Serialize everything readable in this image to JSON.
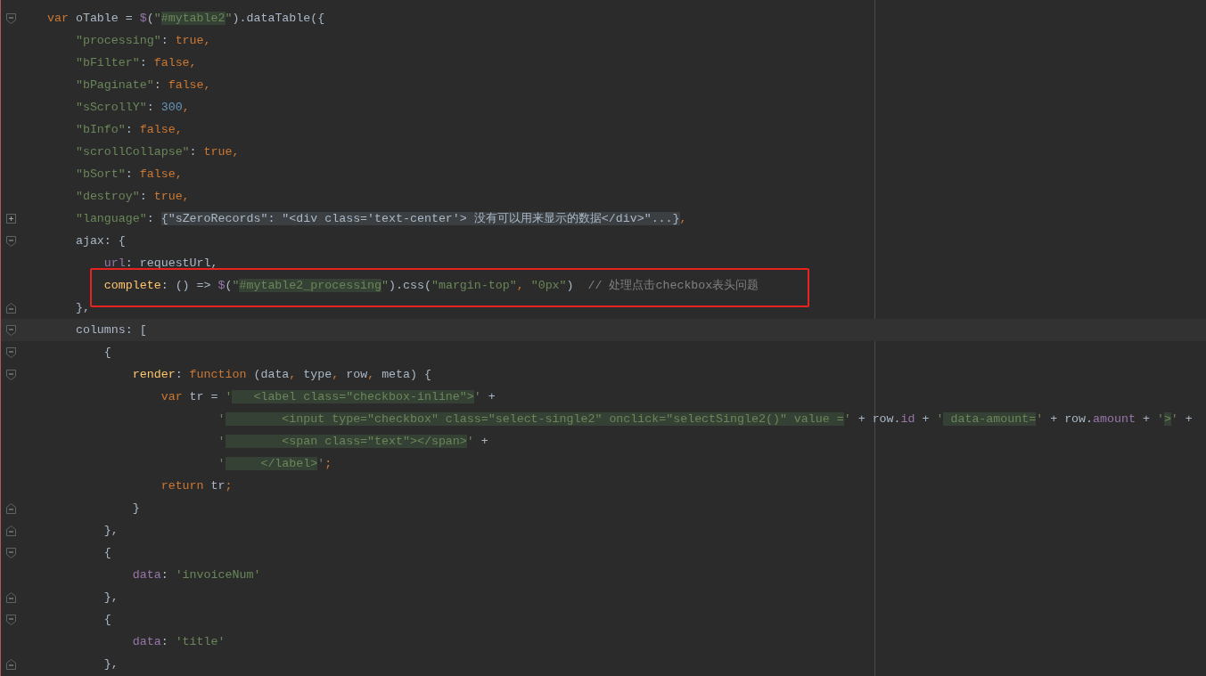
{
  "editor": {
    "lines": [
      {
        "kind": "fold-start",
        "tokens": [
          {
            "text": "var ",
            "kind": "keyword"
          },
          {
            "text": "oTable = ",
            "kind": "plain"
          },
          {
            "text": "$",
            "kind": "field"
          },
          {
            "text": "(",
            "kind": "plain"
          },
          {
            "text": "\"",
            "kind": "string"
          },
          {
            "text": "#mytable2",
            "kind": "injected"
          },
          {
            "text": "\"",
            "kind": "string"
          },
          {
            "text": ").dataTable({",
            "kind": "plain"
          }
        ]
      },
      {
        "kind": "plain",
        "tokens": [
          {
            "text": "    \"processing\"",
            "kind": "string"
          },
          {
            "text": ": ",
            "kind": "plain"
          },
          {
            "text": "true,",
            "kind": "keyword"
          }
        ]
      },
      {
        "kind": "plain",
        "tokens": [
          {
            "text": "    \"bFilter\"",
            "kind": "string"
          },
          {
            "text": ": ",
            "kind": "plain"
          },
          {
            "text": "false,",
            "kind": "keyword"
          }
        ]
      },
      {
        "kind": "plain",
        "tokens": [
          {
            "text": "    \"bPaginate\"",
            "kind": "string"
          },
          {
            "text": ": ",
            "kind": "plain"
          },
          {
            "text": "false,",
            "kind": "keyword"
          }
        ]
      },
      {
        "kind": "plain",
        "tokens": [
          {
            "text": "    \"sScrollY\"",
            "kind": "string"
          },
          {
            "text": ": ",
            "kind": "plain"
          },
          {
            "text": "300",
            "kind": "number"
          },
          {
            "text": ",",
            "kind": "keyword"
          }
        ]
      },
      {
        "kind": "plain",
        "tokens": [
          {
            "text": "    \"bInfo\"",
            "kind": "string"
          },
          {
            "text": ": ",
            "kind": "plain"
          },
          {
            "text": "false,",
            "kind": "keyword"
          }
        ]
      },
      {
        "kind": "plain",
        "tokens": [
          {
            "text": "    \"scrollCollapse\"",
            "kind": "string"
          },
          {
            "text": ": ",
            "kind": "plain"
          },
          {
            "text": "true,",
            "kind": "keyword"
          }
        ]
      },
      {
        "kind": "plain",
        "tokens": [
          {
            "text": "    \"bSort\"",
            "kind": "string"
          },
          {
            "text": ": ",
            "kind": "plain"
          },
          {
            "text": "false,",
            "kind": "keyword"
          }
        ]
      },
      {
        "kind": "plain",
        "tokens": [
          {
            "text": "    \"destroy\"",
            "kind": "string"
          },
          {
            "text": ": ",
            "kind": "plain"
          },
          {
            "text": "true,",
            "kind": "keyword"
          }
        ]
      },
      {
        "kind": "folded",
        "tokens": [
          {
            "text": "    \"language\"",
            "kind": "string"
          },
          {
            "text": ": ",
            "kind": "plain"
          },
          {
            "text": "{\"sZeroRecords\": \"<div class='text-center'> 没有可以用来显示的数据</div>\"...}",
            "kind": "folded"
          },
          {
            "text": ",",
            "kind": "keyword"
          }
        ]
      },
      {
        "kind": "fold-start",
        "tokens": [
          {
            "text": "    ajax: {",
            "kind": "plain"
          }
        ]
      },
      {
        "kind": "plain",
        "tokens": [
          {
            "text": "        url",
            "kind": "field"
          },
          {
            "text": ": requestUrl,",
            "kind": "plain"
          }
        ]
      },
      {
        "kind": "plain",
        "annotated": true,
        "tokens": [
          {
            "text": "        complete",
            "kind": "function"
          },
          {
            "text": ": () => ",
            "kind": "plain"
          },
          {
            "text": "$",
            "kind": "field"
          },
          {
            "text": "(",
            "kind": "plain"
          },
          {
            "text": "\"",
            "kind": "string"
          },
          {
            "text": "#mytable2_processing",
            "kind": "injected"
          },
          {
            "text": "\"",
            "kind": "string"
          },
          {
            "text": ").css(",
            "kind": "plain"
          },
          {
            "text": "\"margin-top\"",
            "kind": "string"
          },
          {
            "text": ", ",
            "kind": "keyword"
          },
          {
            "text": "\"0px\"",
            "kind": "string"
          },
          {
            "text": ")  ",
            "kind": "plain"
          },
          {
            "text": "// 处理点击checkbox表头问题",
            "kind": "comment"
          }
        ]
      },
      {
        "kind": "fold-end",
        "tokens": [
          {
            "text": "    },",
            "kind": "plain"
          }
        ]
      },
      {
        "kind": "fold-start",
        "current": true,
        "tokens": [
          {
            "text": "    columns: ",
            "kind": "plain"
          },
          {
            "text": "[",
            "kind": "plain"
          }
        ]
      },
      {
        "kind": "fold-start",
        "tokens": [
          {
            "text": "        {",
            "kind": "plain"
          }
        ]
      },
      {
        "kind": "fold-start",
        "tokens": [
          {
            "text": "            render",
            "kind": "function"
          },
          {
            "text": ": ",
            "kind": "plain"
          },
          {
            "text": "function ",
            "kind": "keyword"
          },
          {
            "text": "(data",
            "kind": "plain"
          },
          {
            "text": ", ",
            "kind": "keyword"
          },
          {
            "text": "type",
            "kind": "plain"
          },
          {
            "text": ", ",
            "kind": "keyword"
          },
          {
            "text": "row",
            "kind": "plain"
          },
          {
            "text": ", ",
            "kind": "keyword"
          },
          {
            "text": "meta) {",
            "kind": "plain"
          }
        ]
      },
      {
        "kind": "plain",
        "tokens": [
          {
            "text": "                var ",
            "kind": "keyword"
          },
          {
            "text": "tr = ",
            "kind": "plain"
          },
          {
            "text": "'",
            "kind": "string"
          },
          {
            "text": "   <label class=\"checkbox-inline\">",
            "kind": "injected"
          },
          {
            "text": "'",
            "kind": "string"
          },
          {
            "text": " +",
            "kind": "plain"
          }
        ]
      },
      {
        "kind": "plain",
        "tokens": [
          {
            "text": "                        '",
            "kind": "string"
          },
          {
            "text": "        <input type=\"checkbox\" class=\"select-single2\" onclick=\"selectSingle2()\" value =",
            "kind": "injected"
          },
          {
            "text": "'",
            "kind": "string"
          },
          {
            "text": " + row.",
            "kind": "plain"
          },
          {
            "text": "id",
            "kind": "field"
          },
          {
            "text": " + ",
            "kind": "plain"
          },
          {
            "text": "'",
            "kind": "string"
          },
          {
            "text": " data-amount=",
            "kind": "injected"
          },
          {
            "text": "'",
            "kind": "string"
          },
          {
            "text": " + row.",
            "kind": "plain"
          },
          {
            "text": "amount",
            "kind": "field"
          },
          {
            "text": " + ",
            "kind": "plain"
          },
          {
            "text": "'",
            "kind": "string"
          },
          {
            "text": ">",
            "kind": "injected"
          },
          {
            "text": "'",
            "kind": "string"
          },
          {
            "text": " +",
            "kind": "plain"
          }
        ]
      },
      {
        "kind": "plain",
        "tokens": [
          {
            "text": "                        '",
            "kind": "string"
          },
          {
            "text": "        <span class=\"text\"></span>",
            "kind": "injected"
          },
          {
            "text": "'",
            "kind": "string"
          },
          {
            "text": " +",
            "kind": "plain"
          }
        ]
      },
      {
        "kind": "plain",
        "tokens": [
          {
            "text": "                        '",
            "kind": "string"
          },
          {
            "text": "     </label>",
            "kind": "injected"
          },
          {
            "text": "'",
            "kind": "string"
          },
          {
            "text": ";",
            "kind": "keyword"
          }
        ]
      },
      {
        "kind": "plain",
        "tokens": [
          {
            "text": "                return ",
            "kind": "keyword"
          },
          {
            "text": "tr",
            "kind": "plain"
          },
          {
            "text": ";",
            "kind": "keyword"
          }
        ]
      },
      {
        "kind": "fold-end",
        "tokens": [
          {
            "text": "            }",
            "kind": "plain"
          }
        ]
      },
      {
        "kind": "fold-end",
        "tokens": [
          {
            "text": "        },",
            "kind": "plain"
          }
        ]
      },
      {
        "kind": "fold-start",
        "tokens": [
          {
            "text": "        {",
            "kind": "plain"
          }
        ]
      },
      {
        "kind": "plain",
        "tokens": [
          {
            "text": "            data",
            "kind": "field"
          },
          {
            "text": ": ",
            "kind": "plain"
          },
          {
            "text": "'invoiceNum'",
            "kind": "string"
          }
        ]
      },
      {
        "kind": "fold-end",
        "tokens": [
          {
            "text": "        },",
            "kind": "plain"
          }
        ]
      },
      {
        "kind": "fold-start",
        "tokens": [
          {
            "text": "        {",
            "kind": "plain"
          }
        ]
      },
      {
        "kind": "plain",
        "tokens": [
          {
            "text": "            data",
            "kind": "field"
          },
          {
            "text": ": ",
            "kind": "plain"
          },
          {
            "text": "'title'",
            "kind": "string"
          }
        ]
      },
      {
        "kind": "fold-end",
        "tokens": [
          {
            "text": "        },",
            "kind": "plain"
          }
        ]
      }
    ]
  }
}
